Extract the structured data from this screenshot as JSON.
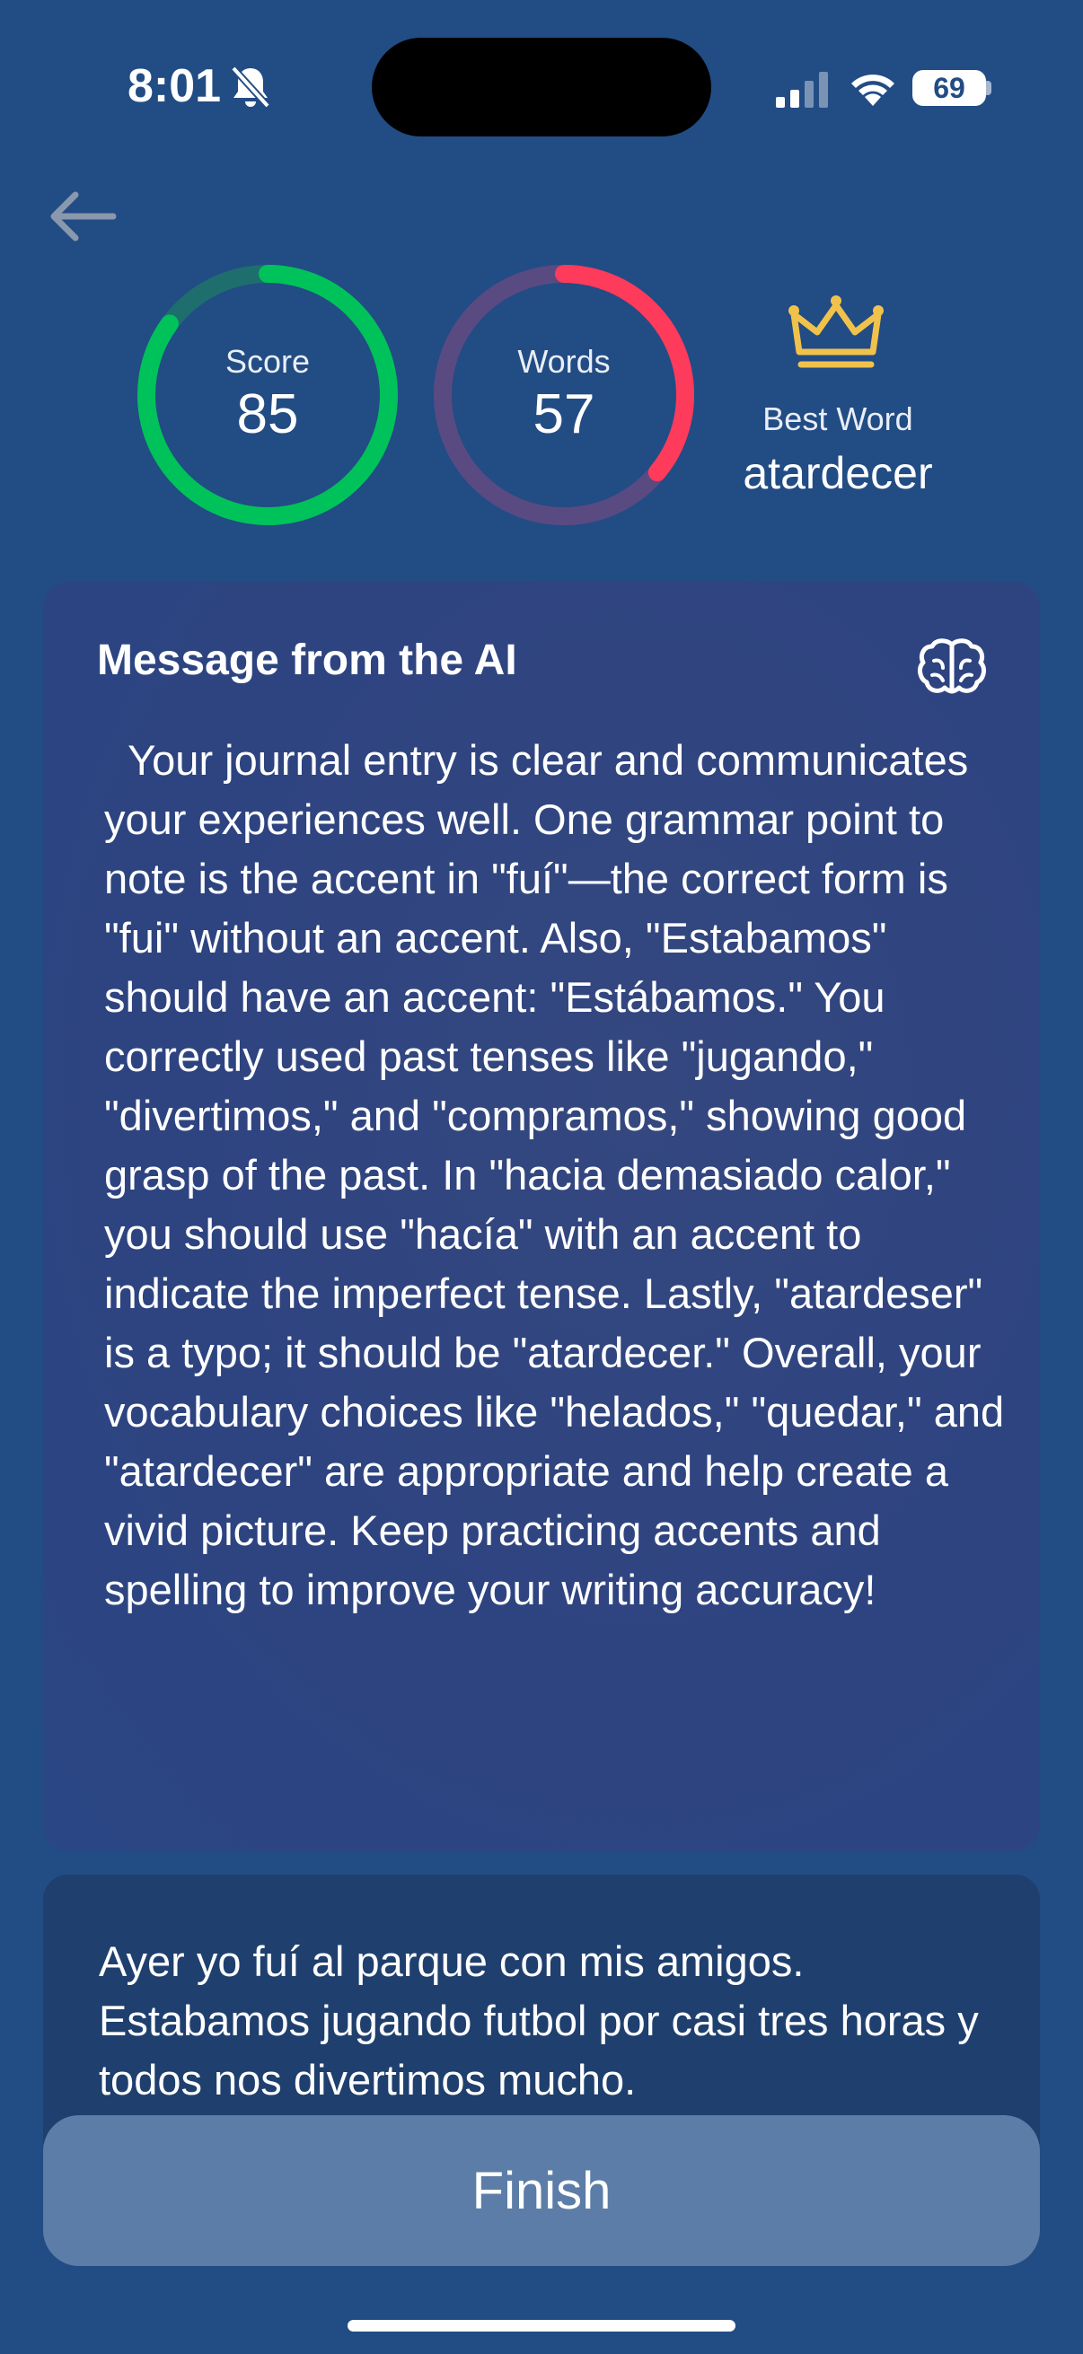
{
  "status_bar": {
    "time": "8:01",
    "battery": "69",
    "battery_level": 0.69,
    "icons": [
      "bell-slash-icon",
      "cellular-signal-icon",
      "wifi-icon",
      "battery-icon"
    ]
  },
  "nav": {
    "back_icon": "arrow-left-icon"
  },
  "stats": {
    "score": {
      "label": "Score",
      "value": "85",
      "progress": 0.85,
      "color": "#00c25a",
      "track_color": "#1f6e6e"
    },
    "words": {
      "label": "Words",
      "value": "57",
      "progress": 0.36,
      "color": "#ff3b5c",
      "track_color": "#5a4a82"
    },
    "best": {
      "icon": "crown-icon",
      "label": "Best Word",
      "word": "atardecer",
      "icon_color": "#f1c24b"
    }
  },
  "ai_card": {
    "title": "Message from the AI",
    "icon": "brain-icon",
    "message": "  Your journal entry is clear and communicates your experiences well. One grammar point to note is the accent in \"fuí\"—the correct form is \"fui\" without an accent. Also, \"Estabamos\" should have an accent: \"Estábamos.\" You correctly used past tenses like \"jugando,\" \"divertimos,\" and \"compramos,\" showing good grasp of the past. In \"hacia demasiado calor,\" you should use \"hacía\" with an accent to indicate the imperfect tense. Lastly, \"atardeser\" is a typo; it should be \"atardecer.\" Overall, your vocabulary choices like \"helados,\" \"quedar,\" and \"atardecer\" are appropriate and help create a vivid picture. Keep practicing accents and spelling to improve your writing accuracy!"
  },
  "journal": {
    "text": "Ayer yo fuí al parque con mis amigos. Estabamos jugando futbol por casi tres horas y todos nos divertimos mucho."
  },
  "finish_button": {
    "label": "Finish"
  }
}
